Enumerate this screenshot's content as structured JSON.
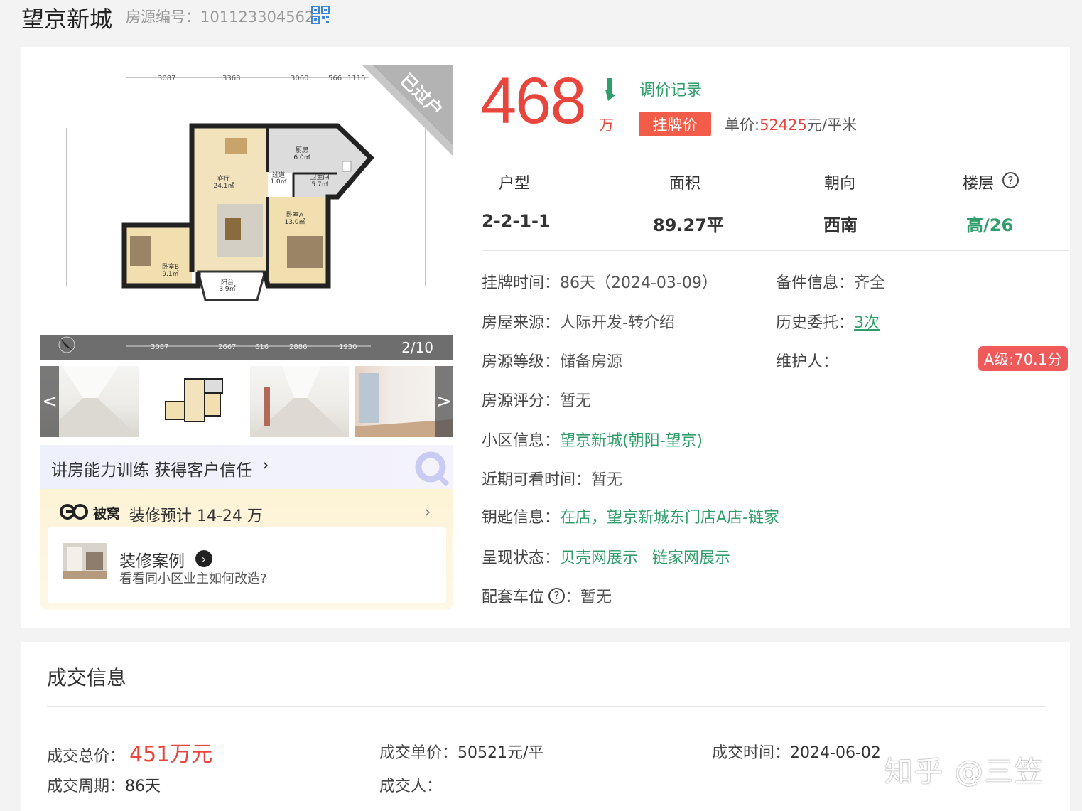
{
  "header": {
    "title": "望京新城",
    "listing_code": "房源编号：101123304562"
  },
  "gallery": {
    "ribbon": "已过户",
    "counter": "2/10",
    "prev": "<",
    "next": ">",
    "plan_dims_top": [
      "3087",
      "3368",
      "3060",
      "566",
      "1115"
    ],
    "plan_dims_bottom": [
      "3087",
      "2667",
      "616",
      "2886",
      "1930"
    ],
    "rooms": {
      "kitchen": "厨房\n6.0㎡",
      "living": "客厅\n24.1㎡",
      "hall": "过道\n1.0㎡",
      "bath": "卫生间\n5.7㎡",
      "bedA": "卧室A\n13.0㎡",
      "bedB": "卧室B\n9.1㎡",
      "balcony": "阳台\n3.9㎡"
    }
  },
  "promo": {
    "training": "讲房能力训练 获得客户信任",
    "brand": "被窝",
    "renovation_estimate": "装修预计 14-24 万",
    "case_title": "装修案例",
    "case_sub": "看看同小区业主如何改造?"
  },
  "price": {
    "total": "468",
    "unit_wan": "万",
    "history_link": "调价记录",
    "tag": "挂牌价",
    "unit_price_label": "单价:",
    "unit_price_value": "52425",
    "unit_price_suffix": "元/平米"
  },
  "specs": [
    {
      "label": "户型",
      "value": "2-2-1-1"
    },
    {
      "label": "面积",
      "value": "89.27平"
    },
    {
      "label": "朝向",
      "value": "西南"
    },
    {
      "label": "楼层",
      "value": "高/26"
    }
  ],
  "info": {
    "listing_time_label": "挂牌时间：",
    "listing_time_value": "86天（2024-03-09）",
    "docs_label": "备件信息：",
    "docs_value": "齐全",
    "source_label": "房屋来源：",
    "source_value": "人际开发-转介绍",
    "history_label": "历史委托：",
    "history_value": "3次",
    "grade_label": "房源等级：",
    "grade_value": "储备房源",
    "maintainer_label": "维护人：",
    "maintainer_badge": "A级:70.1分",
    "score_label": "房源评分：",
    "score_value": "暂无",
    "community_label": "小区信息：",
    "community_value": "望京新城(朝阳-望京)",
    "viewing_label": "近期可看时间：",
    "viewing_value": "暂无",
    "key_label": "钥匙信息：",
    "key_value": "在店，望京新城东门店A店-链家",
    "display_label": "呈现状态：",
    "display_beike": "贝壳网展示",
    "display_lianjia": "链家网展示",
    "parking_label": "配套车位",
    "parking_value": "：暂无"
  },
  "deal": {
    "title": "成交信息",
    "total_label": "成交总价：",
    "total_value": "451万元",
    "unit_label": "成交单价：",
    "unit_value": "50521元/平",
    "time_label": "成交时间：",
    "time_value": "2024-06-02",
    "cycle_label": "成交周期：",
    "cycle_value": "86天",
    "person_label": "成交人："
  },
  "watermark": "知乎 @三笠",
  "colors": {
    "price_red": "#e8453c",
    "link_green": "#2f9e6b",
    "tag_red": "#f25c49"
  }
}
